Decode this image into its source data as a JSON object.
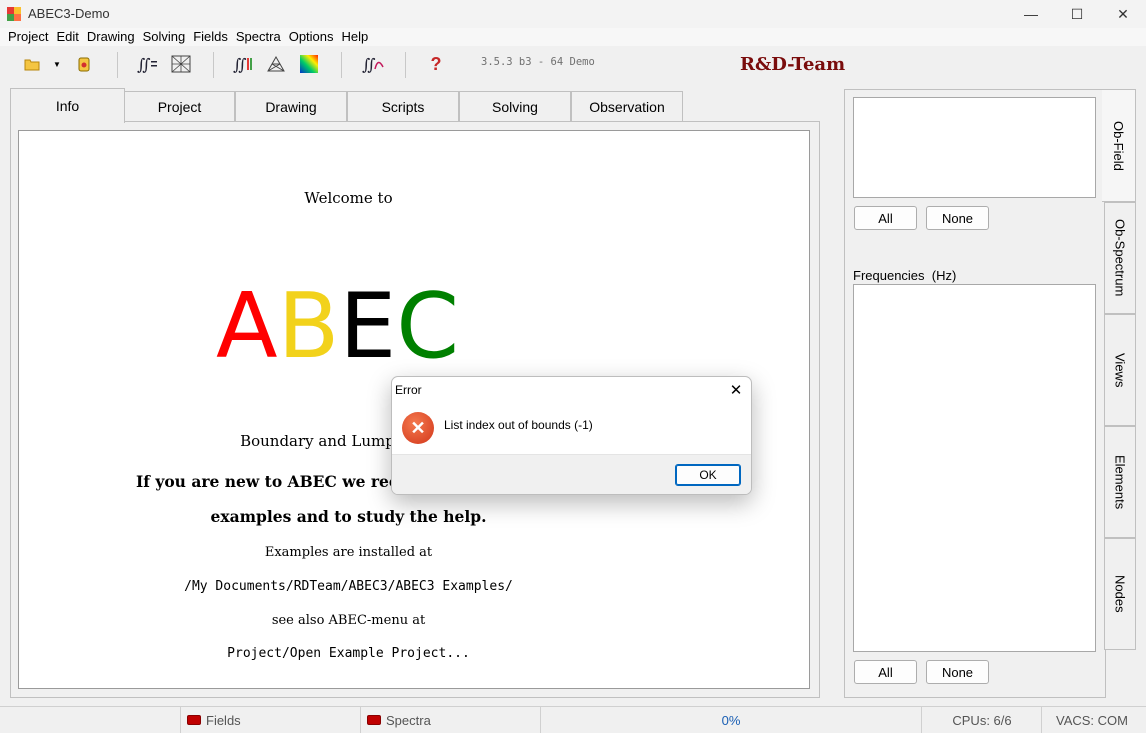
{
  "window": {
    "title": "ABEC3-Demo",
    "minimize": "—",
    "maximize": "☐",
    "close": "✕"
  },
  "menu": [
    "Project",
    "Edit",
    "Drawing",
    "Solving",
    "Fields",
    "Spectra",
    "Options",
    "Help"
  ],
  "toolbar": {
    "version": "3.5.3 b3 - 64 Demo",
    "brand": "R&D-Team"
  },
  "tabs": [
    "Info",
    "Project",
    "Drawing",
    "Scripts",
    "Solving",
    "Observation"
  ],
  "info": {
    "welcome": "Welcome to",
    "logo": {
      "letters": [
        "A",
        "B",
        "E",
        "C"
      ],
      "colors": [
        "#ff0000",
        "#f2d21b",
        "#000000",
        "#008000"
      ]
    },
    "subtitle": "Boundary and Lumped Elem",
    "new_line1": "If you are new to ABEC we recomm",
    "new_line2": "examples and to study the help.",
    "examples_installed": "Examples are installed at",
    "examples_path": "/My Documents/RDTeam/ABEC3/ABEC3 Examples/",
    "see_also": "see also ABEC-menu at",
    "menu_path": "Project/Open Example Project..."
  },
  "right_panel": {
    "all_label": "All",
    "none_label": "None",
    "frequencies_label": "Frequencies  (Hz)",
    "side_tabs": [
      "Ob-Field",
      "Ob-Spectrum",
      "Views",
      "Elements",
      "Nodes"
    ]
  },
  "statusbar": {
    "fields": "Fields",
    "spectra": "Spectra",
    "progress": "0%",
    "cpus": "CPUs: 6/6",
    "vacs": "VACS: COM"
  },
  "dialog": {
    "title": "Error",
    "message": "List index out of bounds (-1)",
    "ok": "OK",
    "close": "✕"
  }
}
